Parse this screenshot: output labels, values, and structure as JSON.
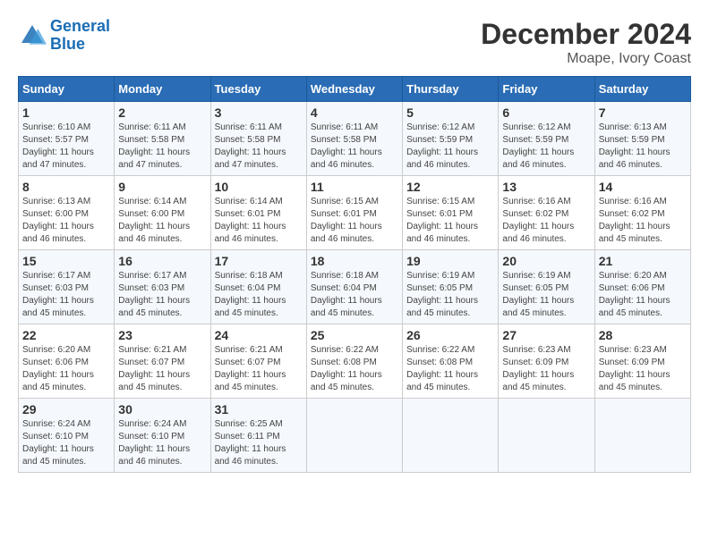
{
  "logo": {
    "line1": "General",
    "line2": "Blue"
  },
  "title": "December 2024",
  "subtitle": "Moape, Ivory Coast",
  "days_of_week": [
    "Sunday",
    "Monday",
    "Tuesday",
    "Wednesday",
    "Thursday",
    "Friday",
    "Saturday"
  ],
  "weeks": [
    [
      {
        "day": 1,
        "info": "Sunrise: 6:10 AM\nSunset: 5:57 PM\nDaylight: 11 hours\nand 47 minutes."
      },
      {
        "day": 2,
        "info": "Sunrise: 6:11 AM\nSunset: 5:58 PM\nDaylight: 11 hours\nand 47 minutes."
      },
      {
        "day": 3,
        "info": "Sunrise: 6:11 AM\nSunset: 5:58 PM\nDaylight: 11 hours\nand 47 minutes."
      },
      {
        "day": 4,
        "info": "Sunrise: 6:11 AM\nSunset: 5:58 PM\nDaylight: 11 hours\nand 46 minutes."
      },
      {
        "day": 5,
        "info": "Sunrise: 6:12 AM\nSunset: 5:59 PM\nDaylight: 11 hours\nand 46 minutes."
      },
      {
        "day": 6,
        "info": "Sunrise: 6:12 AM\nSunset: 5:59 PM\nDaylight: 11 hours\nand 46 minutes."
      },
      {
        "day": 7,
        "info": "Sunrise: 6:13 AM\nSunset: 5:59 PM\nDaylight: 11 hours\nand 46 minutes."
      }
    ],
    [
      {
        "day": 8,
        "info": "Sunrise: 6:13 AM\nSunset: 6:00 PM\nDaylight: 11 hours\nand 46 minutes."
      },
      {
        "day": 9,
        "info": "Sunrise: 6:14 AM\nSunset: 6:00 PM\nDaylight: 11 hours\nand 46 minutes."
      },
      {
        "day": 10,
        "info": "Sunrise: 6:14 AM\nSunset: 6:01 PM\nDaylight: 11 hours\nand 46 minutes."
      },
      {
        "day": 11,
        "info": "Sunrise: 6:15 AM\nSunset: 6:01 PM\nDaylight: 11 hours\nand 46 minutes."
      },
      {
        "day": 12,
        "info": "Sunrise: 6:15 AM\nSunset: 6:01 PM\nDaylight: 11 hours\nand 46 minutes."
      },
      {
        "day": 13,
        "info": "Sunrise: 6:16 AM\nSunset: 6:02 PM\nDaylight: 11 hours\nand 46 minutes."
      },
      {
        "day": 14,
        "info": "Sunrise: 6:16 AM\nSunset: 6:02 PM\nDaylight: 11 hours\nand 45 minutes."
      }
    ],
    [
      {
        "day": 15,
        "info": "Sunrise: 6:17 AM\nSunset: 6:03 PM\nDaylight: 11 hours\nand 45 minutes."
      },
      {
        "day": 16,
        "info": "Sunrise: 6:17 AM\nSunset: 6:03 PM\nDaylight: 11 hours\nand 45 minutes."
      },
      {
        "day": 17,
        "info": "Sunrise: 6:18 AM\nSunset: 6:04 PM\nDaylight: 11 hours\nand 45 minutes."
      },
      {
        "day": 18,
        "info": "Sunrise: 6:18 AM\nSunset: 6:04 PM\nDaylight: 11 hours\nand 45 minutes."
      },
      {
        "day": 19,
        "info": "Sunrise: 6:19 AM\nSunset: 6:05 PM\nDaylight: 11 hours\nand 45 minutes."
      },
      {
        "day": 20,
        "info": "Sunrise: 6:19 AM\nSunset: 6:05 PM\nDaylight: 11 hours\nand 45 minutes."
      },
      {
        "day": 21,
        "info": "Sunrise: 6:20 AM\nSunset: 6:06 PM\nDaylight: 11 hours\nand 45 minutes."
      }
    ],
    [
      {
        "day": 22,
        "info": "Sunrise: 6:20 AM\nSunset: 6:06 PM\nDaylight: 11 hours\nand 45 minutes."
      },
      {
        "day": 23,
        "info": "Sunrise: 6:21 AM\nSunset: 6:07 PM\nDaylight: 11 hours\nand 45 minutes."
      },
      {
        "day": 24,
        "info": "Sunrise: 6:21 AM\nSunset: 6:07 PM\nDaylight: 11 hours\nand 45 minutes."
      },
      {
        "day": 25,
        "info": "Sunrise: 6:22 AM\nSunset: 6:08 PM\nDaylight: 11 hours\nand 45 minutes."
      },
      {
        "day": 26,
        "info": "Sunrise: 6:22 AM\nSunset: 6:08 PM\nDaylight: 11 hours\nand 45 minutes."
      },
      {
        "day": 27,
        "info": "Sunrise: 6:23 AM\nSunset: 6:09 PM\nDaylight: 11 hours\nand 45 minutes."
      },
      {
        "day": 28,
        "info": "Sunrise: 6:23 AM\nSunset: 6:09 PM\nDaylight: 11 hours\nand 45 minutes."
      }
    ],
    [
      {
        "day": 29,
        "info": "Sunrise: 6:24 AM\nSunset: 6:10 PM\nDaylight: 11 hours\nand 45 minutes."
      },
      {
        "day": 30,
        "info": "Sunrise: 6:24 AM\nSunset: 6:10 PM\nDaylight: 11 hours\nand 46 minutes."
      },
      {
        "day": 31,
        "info": "Sunrise: 6:25 AM\nSunset: 6:11 PM\nDaylight: 11 hours\nand 46 minutes."
      },
      null,
      null,
      null,
      null
    ]
  ]
}
